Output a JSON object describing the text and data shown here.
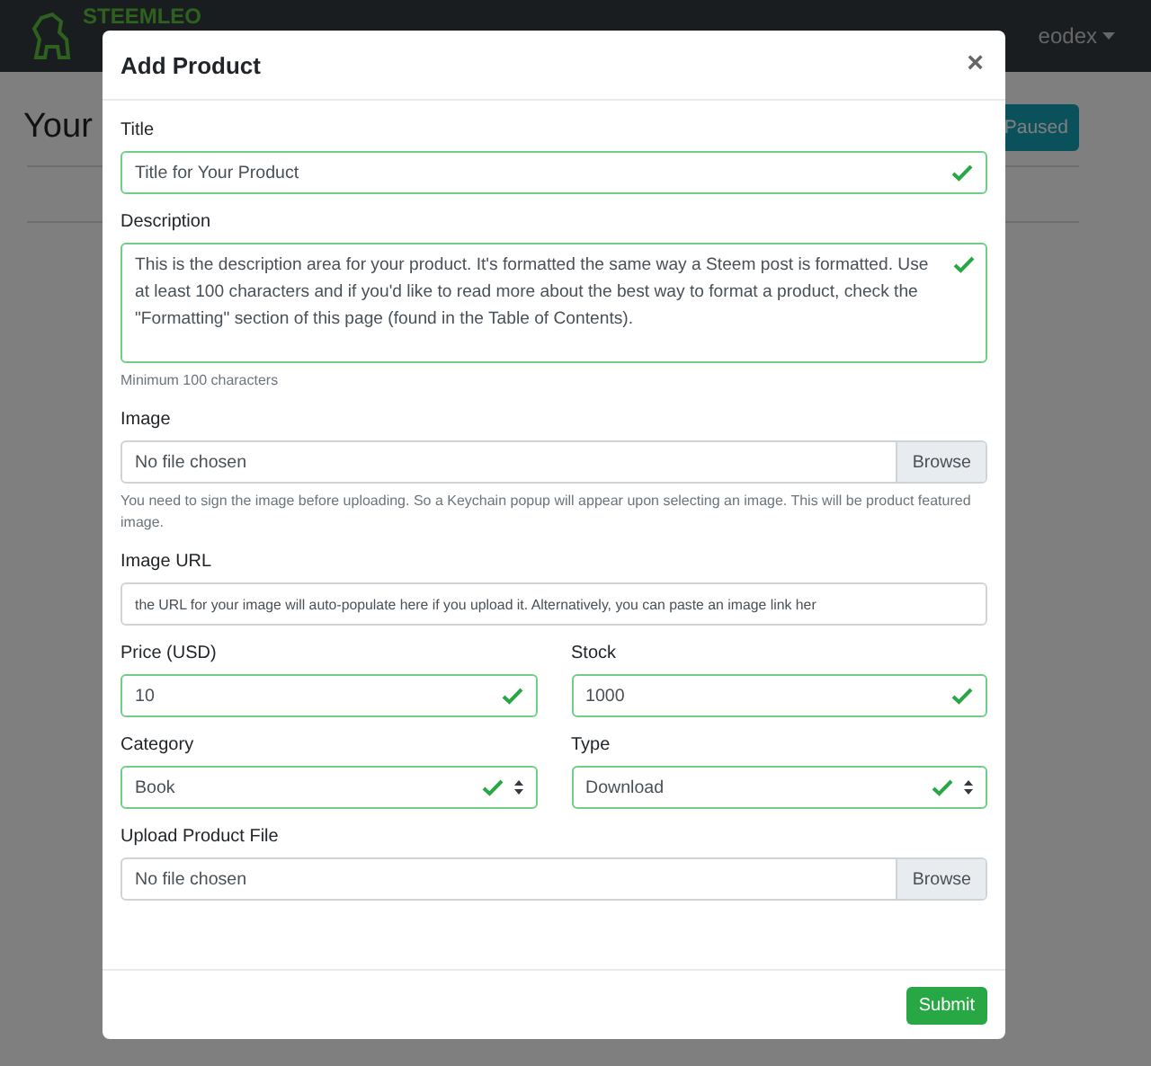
{
  "navbar": {
    "logo": "STEEMLEO",
    "user": "eodex"
  },
  "page": {
    "heading": "Your",
    "status_button": "Paused"
  },
  "modal": {
    "title": "Add Product",
    "close": "×",
    "rows": [
      {
        "fields": [
          {
            "kind": "text",
            "label": "Title",
            "value": "Title for Your Product",
            "valid": true
          }
        ]
      },
      {
        "fields": [
          {
            "kind": "textarea",
            "label": "Description",
            "value": "This is the description area for your product. It's formatted the same way a Steem post is formatted. Use at least 100 characters and if you'd like to read more about the best way to format a product, check the \"Formatting\" section of this page (found in the Table of Contents).",
            "valid": true,
            "help": "Minimum 100 characters"
          }
        ]
      },
      {
        "fields": [
          {
            "kind": "file",
            "label": "Image",
            "value": "No file chosen",
            "button": "Browse",
            "help": "You need to sign the image before uploading. So a Keychain popup will appear upon selecting an image. This will be product featured image."
          }
        ]
      },
      {
        "fields": [
          {
            "kind": "text",
            "label": "Image URL",
            "value": "the URL for your image will auto-populate here if you upload it. Alternatively, you can paste an image link her"
          }
        ]
      },
      {
        "fields": [
          {
            "kind": "text",
            "label": "Price (USD)",
            "value": "10",
            "valid": true
          },
          {
            "kind": "text",
            "label": "Stock",
            "value": "1000",
            "valid": true
          }
        ]
      },
      {
        "fields": [
          {
            "kind": "select",
            "label": "Category",
            "value": "Book",
            "valid": true
          },
          {
            "kind": "select",
            "label": "Type",
            "value": "Download",
            "valid": true
          }
        ]
      },
      {
        "fields": [
          {
            "kind": "file",
            "label": "Upload Product File",
            "value": "No file chosen",
            "button": "Browse"
          }
        ]
      }
    ],
    "submit": "Submit"
  }
}
